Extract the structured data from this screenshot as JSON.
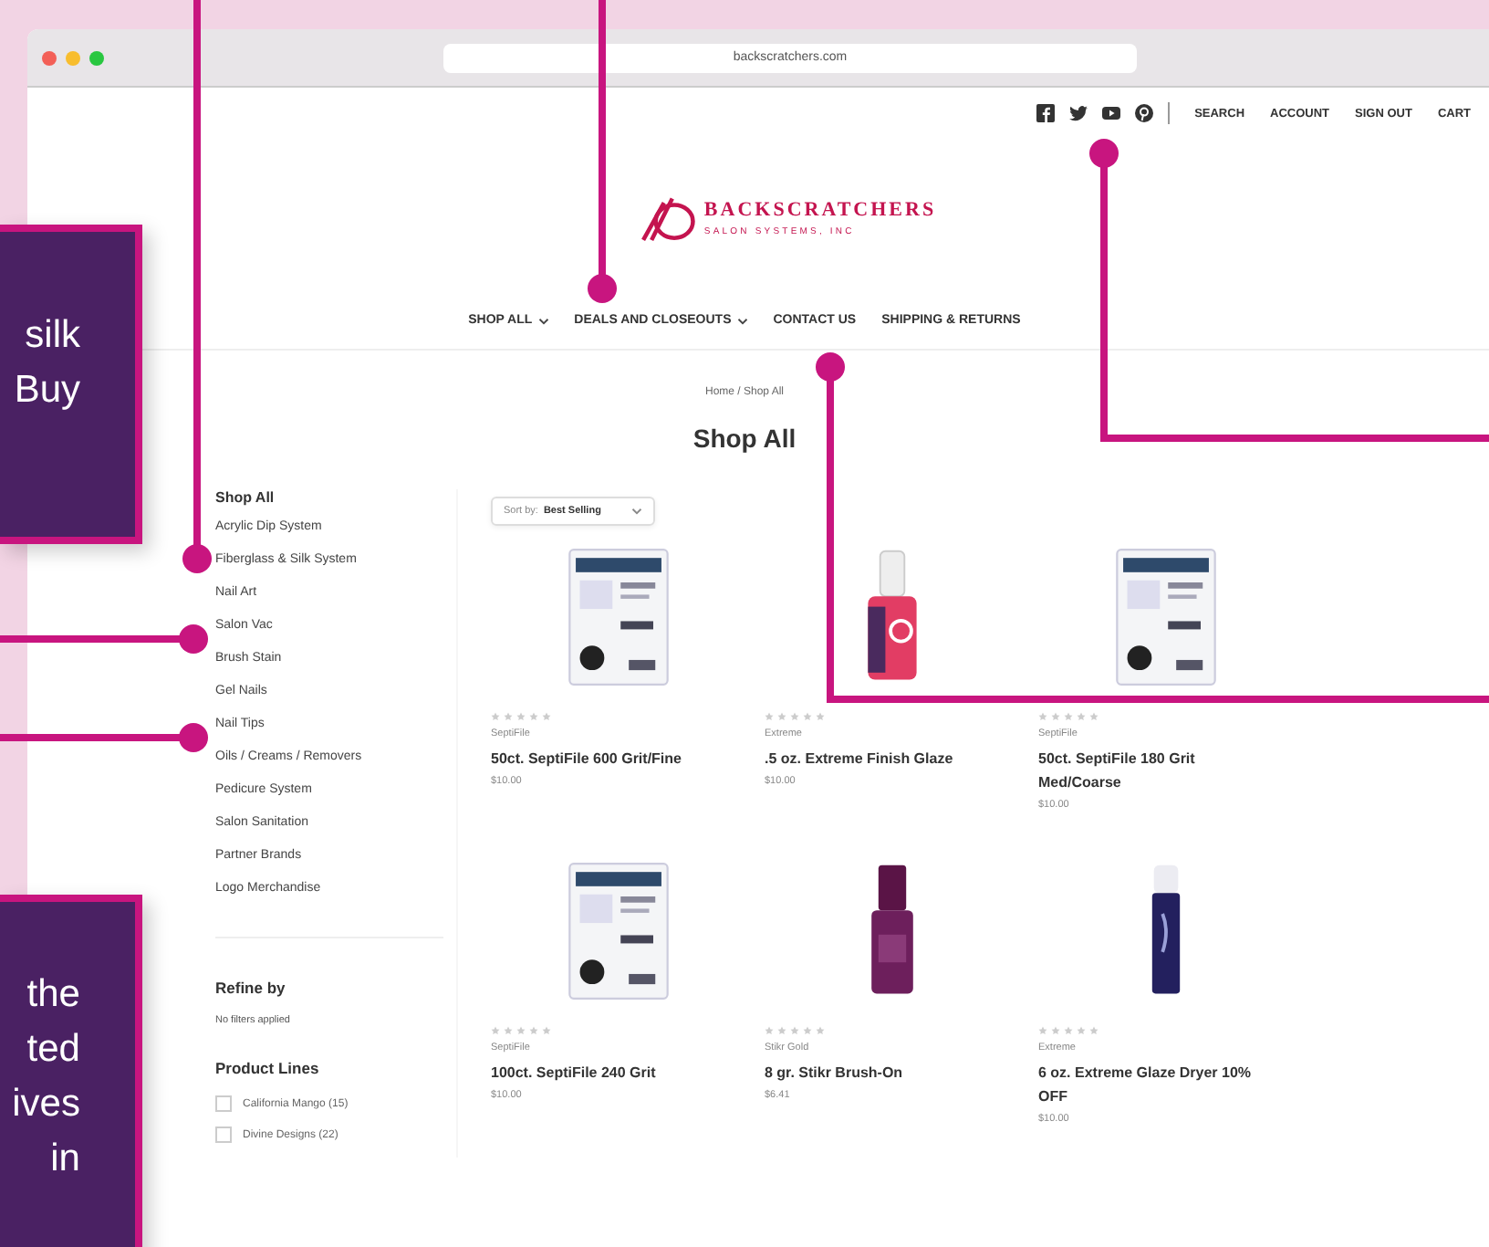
{
  "browser": {
    "url": "backscratchers.com"
  },
  "top_links": [
    "SEARCH",
    "ACCOUNT",
    "SIGN OUT",
    "CART"
  ],
  "logo": {
    "name": "BACKSCRATCHERS",
    "tagline": "SALON SYSTEMS, INC"
  },
  "nav": [
    {
      "label": "SHOP ALL",
      "dropdown": true
    },
    {
      "label": "DEALS AND CLOSEOUTS",
      "dropdown": true
    },
    {
      "label": "CONTACT US",
      "dropdown": false
    },
    {
      "label": "SHIPPING & RETURNS",
      "dropdown": false
    }
  ],
  "breadcrumb": "Home / Shop All",
  "page_title": "Shop All",
  "sidebar": {
    "heading": "Shop All",
    "categories": [
      "Acrylic Dip System",
      "Fiberglass & Silk System",
      "Nail Art",
      "Salon Vac",
      "Brush Stain",
      "Gel Nails",
      "Nail Tips",
      "Oils / Creams / Removers",
      "Pedicure System",
      "Salon Sanitation",
      "Partner Brands",
      "Logo Merchandise"
    ],
    "refine_heading": "Refine by",
    "filters_note": "No filters applied",
    "product_lines_heading": "Product Lines",
    "product_lines": [
      {
        "label": "California Mango (15)",
        "checked": false
      },
      {
        "label": "Divine Designs (22)",
        "checked": false
      }
    ]
  },
  "sort": {
    "label": "Sort by:",
    "value": "Best Selling"
  },
  "products": [
    {
      "kind": "file-pack",
      "stars": 0,
      "brand": "SeptiFile",
      "name": "50ct. SeptiFile 600 Grit/Fine",
      "price": "$10.00"
    },
    {
      "kind": "bottle",
      "stars": 0,
      "brand": "Extreme",
      "name": ".5 oz. Extreme Finish Glaze",
      "price": "$10.00"
    },
    {
      "kind": "file-pack",
      "stars": 0,
      "brand": "SeptiFile",
      "name": "50ct. SeptiFile 180 Grit Med/Coarse",
      "price": "$10.00"
    },
    {
      "kind": "file-pack",
      "stars": 0,
      "brand": "SeptiFile",
      "name": "100ct. SeptiFile 240 Grit",
      "price": "$10.00"
    },
    {
      "kind": "polish",
      "stars": 0,
      "brand": "Stikr Gold",
      "name": "8 gr. Stikr Brush-On",
      "price": "$6.41"
    },
    {
      "kind": "spray",
      "stars": 0,
      "brand": "Extreme",
      "name": "6 oz. Extreme Glaze Dryer 10% OFF",
      "price": "$10.00"
    }
  ],
  "callouts": [
    {
      "lines": [
        "silk",
        "Buy"
      ]
    },
    {
      "lines": [
        "the",
        "ted",
        "ives",
        "in"
      ]
    }
  ]
}
